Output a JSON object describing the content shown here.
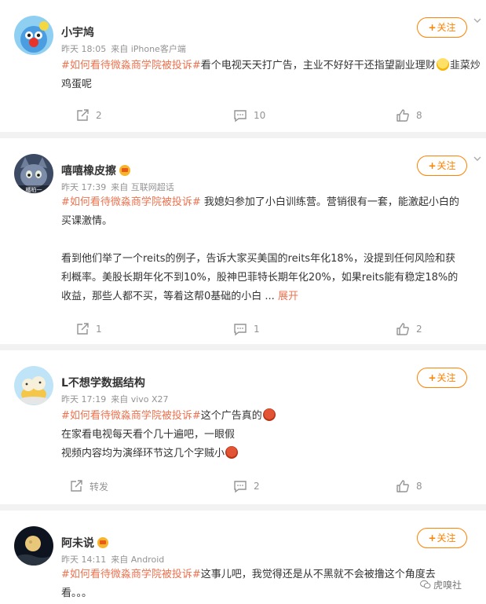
{
  "posts": [
    {
      "user": "小宇鸠",
      "time": "昨天 18:05",
      "source": "来自 iPhone客户端",
      "follow_label": "关注",
      "topic": "#如何看待微淼商学院被投诉#",
      "line1_rest": "看个电视天天打广告，主业不好好干还指望副业理财",
      "line2": "韭菜炒鸡蛋呢",
      "repost_count": "2",
      "comment_count": "10",
      "like_count": "8"
    },
    {
      "user": "嘻嘻橡皮擦",
      "avatar_tag": "橘柏一",
      "time": "昨天 17:39",
      "source": "来自 互联网超话",
      "follow_label": "关注",
      "topic": "#如何看待微淼商学院被投诉#",
      "line1_rest": " 我媳妇参加了小白训练营。营销很有一套，能激起小白的",
      "line2": "买课激情。",
      "line3": "看到他们举了一个reits的例子，告诉大家买美国的reits年化18%，没提到任何风险和获",
      "line4": "利概率。美股长期年化不到10%，股神巴菲特长期年化20%，如果reits能有稳定18%的",
      "line5": "收益，那些人都不买，等着这帮0基础的小白 ...",
      "more_label": "展开",
      "repost_count": "1",
      "comment_count": "1",
      "like_count": "2"
    },
    {
      "user": "L不想学数据结构",
      "time": "昨天 17:19",
      "source": "来自 vivo X27",
      "follow_label": "关注",
      "topic": "#如何看待微淼商学院被投诉#",
      "line1_rest": "这个广告真的",
      "line2": "在家看电视每天看个几十遍吧，一眼假",
      "line3": "视频内容均为演绎环节这几个字贼小",
      "repost_label": "转发",
      "comment_count": "2",
      "like_count": "8"
    },
    {
      "user": "阿未说",
      "time": "昨天 14:11",
      "source": "来自 Android",
      "follow_label": "关注",
      "topic": "#如何看待微淼商学院被投诉#",
      "line1_rest": "这事儿吧，我觉得还是从不黑就不会被撸这个角度去",
      "line2": "看。。。"
    }
  ],
  "watermark": "虎嗅社",
  "colors": {
    "accent": "#ff8200",
    "topic": "#eb7350",
    "meta": "#939393",
    "background": "#f2f2f2"
  }
}
